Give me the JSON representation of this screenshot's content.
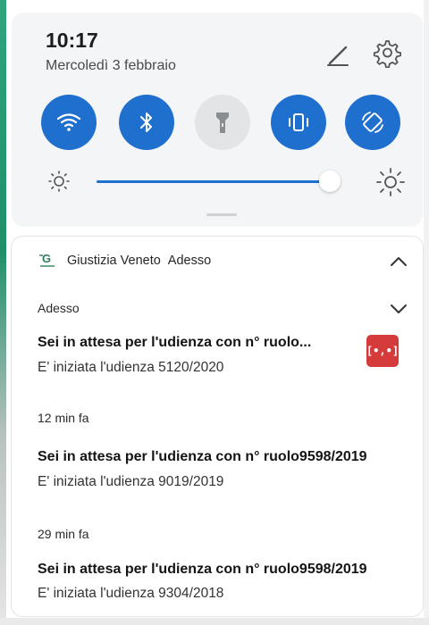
{
  "header": {
    "time": "10:17",
    "date": "Mercoledì 3 febbraio"
  },
  "quick_settings": {
    "tiles": [
      {
        "name": "wifi",
        "icon": "wifi-icon",
        "state": "on"
      },
      {
        "name": "bluetooth",
        "icon": "bluetooth-icon",
        "state": "on"
      },
      {
        "name": "flashlight",
        "icon": "flashlight-icon",
        "state": "off"
      },
      {
        "name": "vibrate",
        "icon": "vibrate-icon",
        "state": "on"
      },
      {
        "name": "auto-rotate",
        "icon": "rotate-icon",
        "state": "on"
      }
    ],
    "brightness_level": 0.9,
    "accent_color": "#1f6fcf"
  },
  "notification_group": {
    "app_name": "Giustizia Veneto",
    "app_time": "Adesso",
    "notifications": [
      {
        "time": "Adesso",
        "title": "Sei in attesa per l'udienza con n° ruolo...",
        "body": "E' iniziata l'udienza 5120/2020"
      },
      {
        "time": "12 min fa",
        "title": "Sei in attesa per l'udienza con n° ruolo9598/2019",
        "body": "E' iniziata l'udienza 9019/2019"
      },
      {
        "time": "29 min fa",
        "title": "Sei in attesa per l'udienza con n° ruolo9598/2019",
        "body": "E' iniziata l'udienza 9304/2018"
      }
    ],
    "thumbnail_text": "[•,•]",
    "thumbnail_color": "#d63b3b"
  }
}
